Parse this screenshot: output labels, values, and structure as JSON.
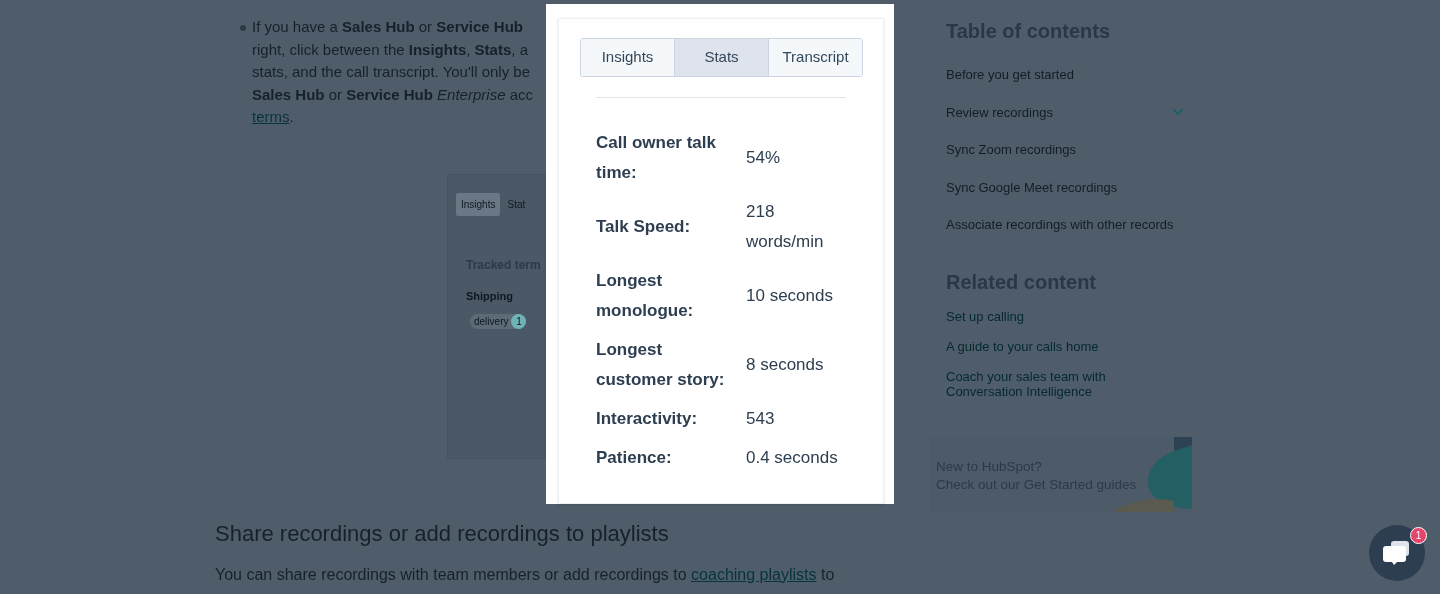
{
  "article": {
    "bullet_lines": [
      {
        "text": "If you have a **Sales Hub** or **Service Hub**"
      },
      {
        "text": "right, click between the **Insights**, **Stats**, a"
      },
      {
        "text": "stats, and the call transcript. You'll only be"
      },
      {
        "text": "**Sales Hub** or **Service Hub** *Enterprise* acc"
      },
      {
        "link": "terms",
        "after": "."
      }
    ],
    "embedded_screenshot": {
      "tabs": [
        {
          "label": "Insights",
          "selected": true
        },
        {
          "label": "Stat",
          "selected": false
        }
      ],
      "heading": "Tracked term",
      "group": "Shipping",
      "tag": {
        "label": "delivery",
        "count": "1"
      }
    },
    "section_heading": "Share recordings or add recordings to playlists",
    "section_paragraph": {
      "before": "You can share recordings with team members or add recordings to ",
      "link": "coaching playlists",
      "after": " to"
    }
  },
  "lightbox": {
    "tabs": [
      {
        "label": "Insights",
        "selected": false
      },
      {
        "label": "Stats",
        "selected": true
      },
      {
        "label": "Transcript",
        "selected": false
      }
    ],
    "stats": [
      {
        "label": "Call owner talk time:",
        "value": "54%"
      },
      {
        "label": "Talk Speed:",
        "value": "218 words/min"
      },
      {
        "label": "Longest monologue:",
        "value": "10 seconds"
      },
      {
        "label": "Longest customer story:",
        "value": "8 seconds"
      },
      {
        "label": "Interactivity:",
        "value": "543"
      },
      {
        "label": "Patience:",
        "value": "0.4 seconds"
      }
    ]
  },
  "sidebar": {
    "toc_title": "Table of contents",
    "toc_items": [
      {
        "label": "Before you get started",
        "expandable": false
      },
      {
        "label": "Review recordings",
        "expandable": true
      },
      {
        "label": "Sync Zoom recordings",
        "expandable": false
      },
      {
        "label": "Sync Google Meet recordings",
        "expandable": false
      },
      {
        "label": "Associate recordings with other records",
        "expandable": false
      }
    ],
    "related_title": "Related content",
    "related_links": [
      "Set up calling",
      "A guide to your calls home",
      "Coach your sales team with Conversation Intelligence"
    ],
    "banner": {
      "title": "New to HubSpot?",
      "subtitle": "Check out our Get Started guides"
    }
  },
  "chat": {
    "badge": "1"
  }
}
